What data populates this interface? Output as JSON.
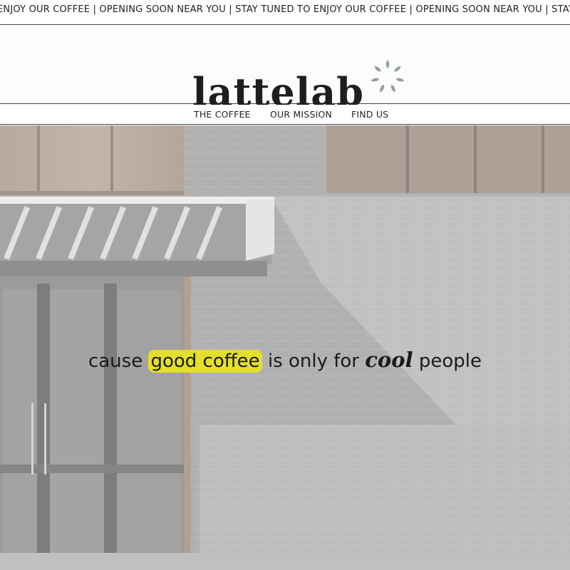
{
  "marquee": {
    "text": "ENJOY OUR COFFEE | OPENING SOON NEAR YOU | STAY TUNED TO ENJOY OUR COFFEE | OPENING SOON NEAR YOU | STAY TUNED"
  },
  "brand": {
    "name": "lattelab",
    "logo_icon": "leaf-wreath-icon",
    "accent_color": "#8fa397"
  },
  "nav": {
    "items": [
      {
        "label": "THE COFFEE"
      },
      {
        "label": "OUR MISSION"
      },
      {
        "label": "FIND US"
      }
    ]
  },
  "hero": {
    "caption_before": "cause",
    "caption_highlight": "good coffee",
    "caption_middle": "is only for",
    "caption_emphasis": "cool",
    "caption_after": "people",
    "highlight_color": "#e3df2a"
  }
}
